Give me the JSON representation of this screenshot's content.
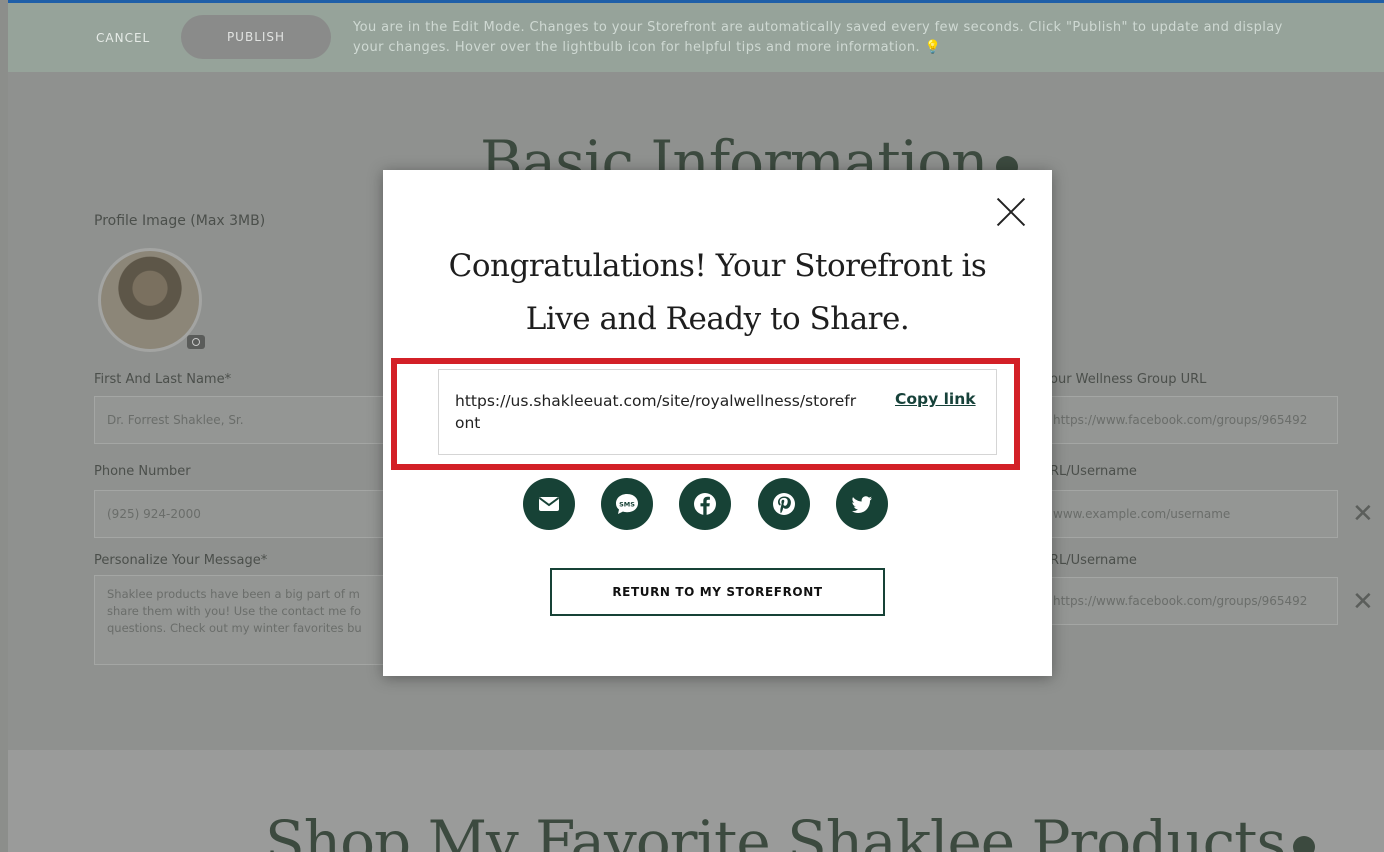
{
  "edit_bar": {
    "cancel_label": "CANCEL",
    "publish_label": "PUBLISH",
    "message": "You are in the Edit Mode. Changes to your Storefront are automatically saved every few seconds. Click \"Publish\" to update and display your changes. Hover over the lightbulb icon for helpful tips and more information.",
    "bulb_icon": "lightbulb-icon"
  },
  "basic_info": {
    "heading": "Basic Information",
    "profile_image_label": "Profile Image (Max 3MB)",
    "name_label": "First And Last Name*",
    "name_value": "Dr. Forrest Shaklee, Sr.",
    "phone_label": "Phone Number",
    "phone_value": "(925) 924-2000",
    "message_label": "Personalize Your Message*",
    "message_value": "Shaklee products have been a big part of m share them with you! Use the contact me fo questions. Check out my winter favorites bu",
    "wellness_label": "our Wellness Group URL",
    "wellness_value": "https://www.facebook.com/groups/965492",
    "url2_label": "RL/Username",
    "url2_placeholder": "www.example.com/username",
    "url3_label": "RL/Username",
    "url3_value": "https://www.facebook.com/groups/965492"
  },
  "shop_section": {
    "heading": "Shop My Favorite Shaklee Products"
  },
  "modal": {
    "title": "Congratulations! Your Storefront is Live and Ready to Share.",
    "url": "https://us.shakleeuat.com/site/royalwellness/storefront",
    "copy_label": "Copy link",
    "share_icons": [
      "email-icon",
      "sms-icon",
      "facebook-icon",
      "pinterest-icon",
      "twitter-icon"
    ],
    "sms_text": "SMS",
    "return_label": "RETURN TO MY STOREFRONT"
  },
  "colors": {
    "brand_green": "#174236",
    "highlight_red": "#d32027",
    "edit_bar_blue": "#1f5fa8"
  }
}
